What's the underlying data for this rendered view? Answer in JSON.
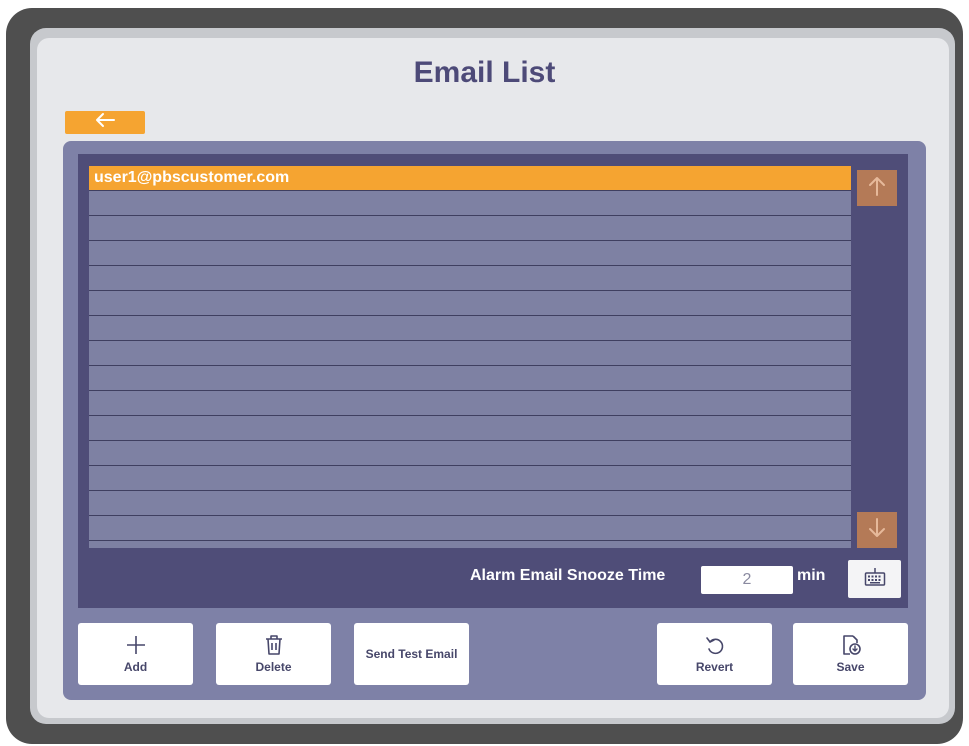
{
  "window": {
    "title": "Email List"
  },
  "email_list": {
    "items": [
      {
        "address": "user1@pbscustomer.com",
        "selected": true
      },
      {
        "address": "",
        "selected": false
      },
      {
        "address": "",
        "selected": false
      },
      {
        "address": "",
        "selected": false
      },
      {
        "address": "",
        "selected": false
      },
      {
        "address": "",
        "selected": false
      },
      {
        "address": "",
        "selected": false
      },
      {
        "address": "",
        "selected": false
      },
      {
        "address": "",
        "selected": false
      },
      {
        "address": "",
        "selected": false
      },
      {
        "address": "",
        "selected": false
      },
      {
        "address": "",
        "selected": false
      },
      {
        "address": "",
        "selected": false
      },
      {
        "address": "",
        "selected": false
      },
      {
        "address": "",
        "selected": false
      }
    ]
  },
  "snooze": {
    "label": "Alarm Email Snooze Time",
    "value": "2",
    "unit": "min"
  },
  "actions": {
    "add": "Add",
    "delete": "Delete",
    "send_test": "Send Test Email",
    "revert": "Revert",
    "save": "Save"
  },
  "icons": {
    "back": "arrow-left-icon",
    "scroll_up": "arrow-up-icon",
    "scroll_down": "arrow-down-icon",
    "keyboard": "keyboard-icon",
    "add": "plus-icon",
    "delete": "trash-icon",
    "revert": "undo-icon",
    "save": "save-file-icon"
  },
  "colors": {
    "accent": "#f5a431",
    "title": "#4d4a78",
    "list_bg": "#7e81a3",
    "frame_dark": "#4f4d78",
    "frame_light": "#7e81a7",
    "scroll_button": "#b47a57"
  }
}
